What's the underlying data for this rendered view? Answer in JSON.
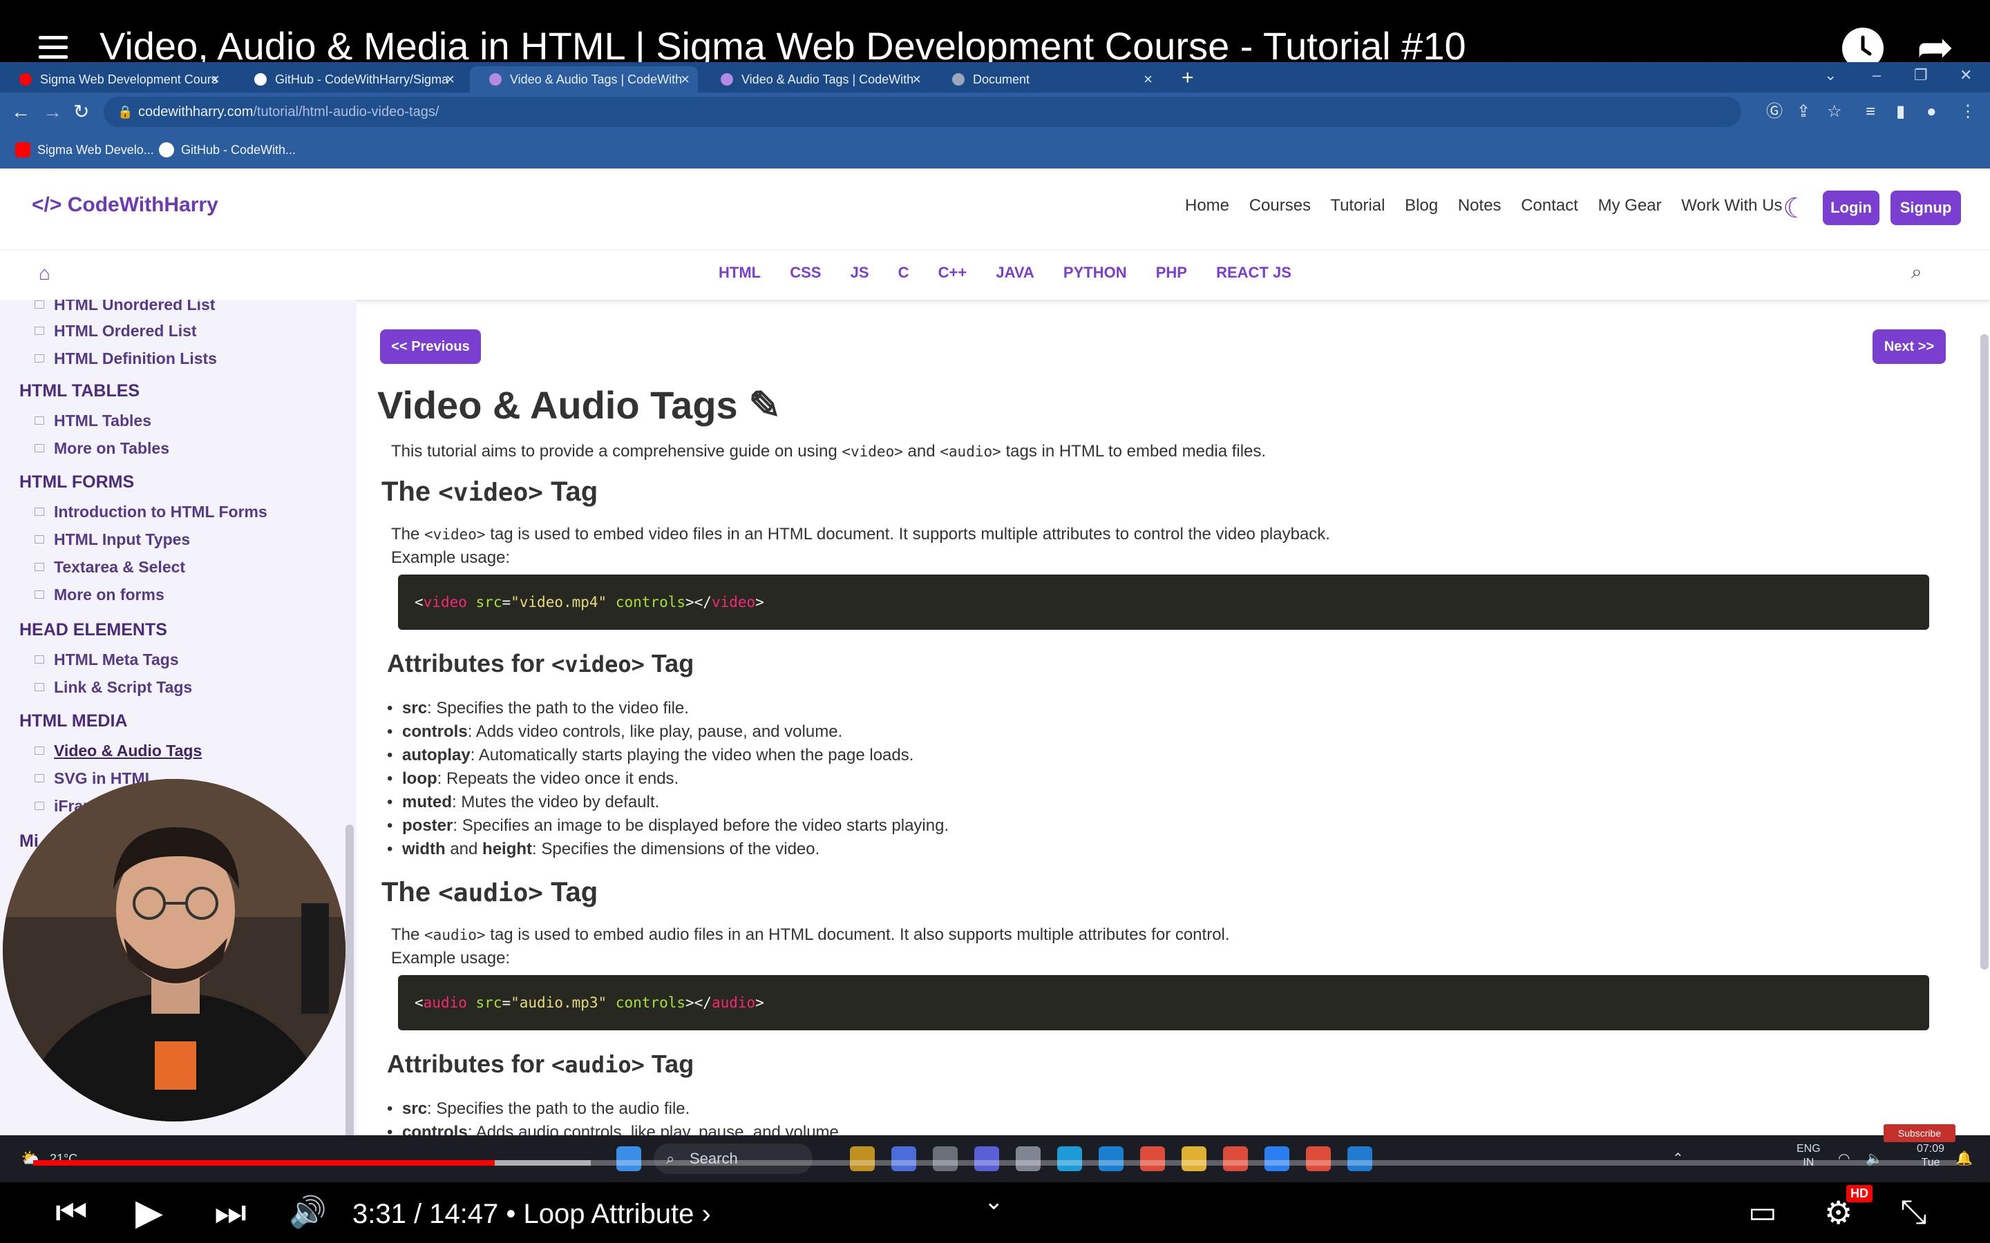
{
  "video": {
    "title": "Video, Audio & Media in HTML | Sigma Web Development Course - Tutorial #10",
    "time": "3:31 / 14:47",
    "chapter": "• Loop Attribute ›",
    "progress": 0.24,
    "buffered": 0.29,
    "hd_badge": "HD",
    "subscribe": "Subscribe"
  },
  "browser": {
    "tabs": [
      {
        "label": "Sigma Web Development Cours",
        "fav_color": "#ff0000"
      },
      {
        "label": "GitHub - CodeWithHarry/Sigma",
        "fav_color": "#ffffff"
      },
      {
        "label": "Video & Audio Tags | CodeWith",
        "fav_color": "#b38be0"
      },
      {
        "label": "Video & Audio Tags | CodeWith",
        "fav_color": "#b38be0"
      },
      {
        "label": "Document",
        "fav_color": "#9aa7bd"
      }
    ],
    "url_host": "codewithharry.com",
    "url_path": "/tutorial/html-audio-video-tags/",
    "bookmarks": [
      {
        "label": "Sigma Web Develo...",
        "color": "#ff0000"
      },
      {
        "label": "GitHub - CodeWith...",
        "color": "#ffffff"
      }
    ]
  },
  "site": {
    "logo": "</> CodeWithHarry",
    "nav": [
      "Home",
      "Courses",
      "Tutorial",
      "Blog",
      "Notes",
      "Contact",
      "My Gear",
      "Work With Us"
    ],
    "login": "Login",
    "signup": "Signup",
    "langs": [
      "HTML",
      "CSS",
      "JS",
      "C",
      "C++",
      "JAVA",
      "PYTHON",
      "PHP",
      "REACT JS"
    ]
  },
  "sidebar": {
    "top_items": [
      "HTML Unordered List",
      "HTML Ordered List",
      "HTML Definition Lists"
    ],
    "sections": [
      {
        "title": "HTML TABLES",
        "items": [
          "HTML Tables",
          "More on Tables"
        ]
      },
      {
        "title": "HTML FORMS",
        "items": [
          "Introduction to HTML Forms",
          "HTML Input Types",
          "Textarea & Select",
          "More on forms"
        ]
      },
      {
        "title": "HEAD ELEMENTS",
        "items": [
          "HTML Meta Tags",
          "Link & Script Tags"
        ]
      },
      {
        "title": "HTML MEDIA",
        "items": [
          "Video & Audio Tags",
          "SVG in HTML",
          "iFrames"
        ]
      }
    ],
    "partial_heading": "Mi"
  },
  "content": {
    "prev": "<< Previous",
    "next": "Next >>",
    "title": "Video & Audio Tags",
    "intro_a": "This tutorial aims to provide a comprehensive guide on using ",
    "intro_video": "<video>",
    "intro_b": " and ",
    "intro_audio": "<audio>",
    "intro_c": " tags in HTML to embed media files.",
    "video_h": {
      "pre": "The ",
      "code": "<video>",
      "post": " Tag"
    },
    "video_p": {
      "pre": "The ",
      "code": "<video>",
      "post": " tag is used to embed video files in an HTML document. It supports multiple attributes to control the video playback."
    },
    "example_usage": "Example usage:",
    "video_code": {
      "tag": "video",
      "attr1": "src",
      "val1": "\"video.mp4\"",
      "attr2": "controls"
    },
    "video_attr_h": {
      "pre": "Attributes for ",
      "code": "<video>",
      "post": " Tag"
    },
    "video_attrs": [
      {
        "name": "src",
        "desc": ": Specifies the path to the video file."
      },
      {
        "name": "controls",
        "desc": ": Adds video controls, like play, pause, and volume."
      },
      {
        "name": "autoplay",
        "desc": ": Automatically starts playing the video when the page loads."
      },
      {
        "name": "loop",
        "desc": ": Repeats the video once it ends."
      },
      {
        "name": "muted",
        "desc": ": Mutes the video by default."
      },
      {
        "name": "poster",
        "desc": ": Specifies an image to be displayed before the video starts playing."
      },
      {
        "name": "width",
        "mid": " and ",
        "name2": "height",
        "desc": ": Specifies the dimensions of the video."
      }
    ],
    "audio_h": {
      "pre": "The ",
      "code": "<audio>",
      "post": " Tag"
    },
    "audio_p": {
      "pre": "The ",
      "code": "<audio>",
      "post": " tag is used to embed audio files in an HTML document. It also supports multiple attributes for control."
    },
    "audio_code": {
      "tag": "audio",
      "attr1": "src",
      "val1": "\"audio.mp3\"",
      "attr2": "controls"
    },
    "audio_attr_h": {
      "pre": "Attributes for ",
      "code": "<audio>",
      "post": " Tag"
    },
    "audio_attrs": [
      {
        "name": "src",
        "desc": ": Specifies the path to the audio file."
      },
      {
        "name": "controls",
        "desc": ": Adds audio controls, like play, pause, and volume."
      }
    ]
  },
  "taskbar": {
    "weather": "21°C",
    "search": "Search",
    "lang": "ENG",
    "region": "IN",
    "time": "07:09",
    "day": "Tue"
  }
}
